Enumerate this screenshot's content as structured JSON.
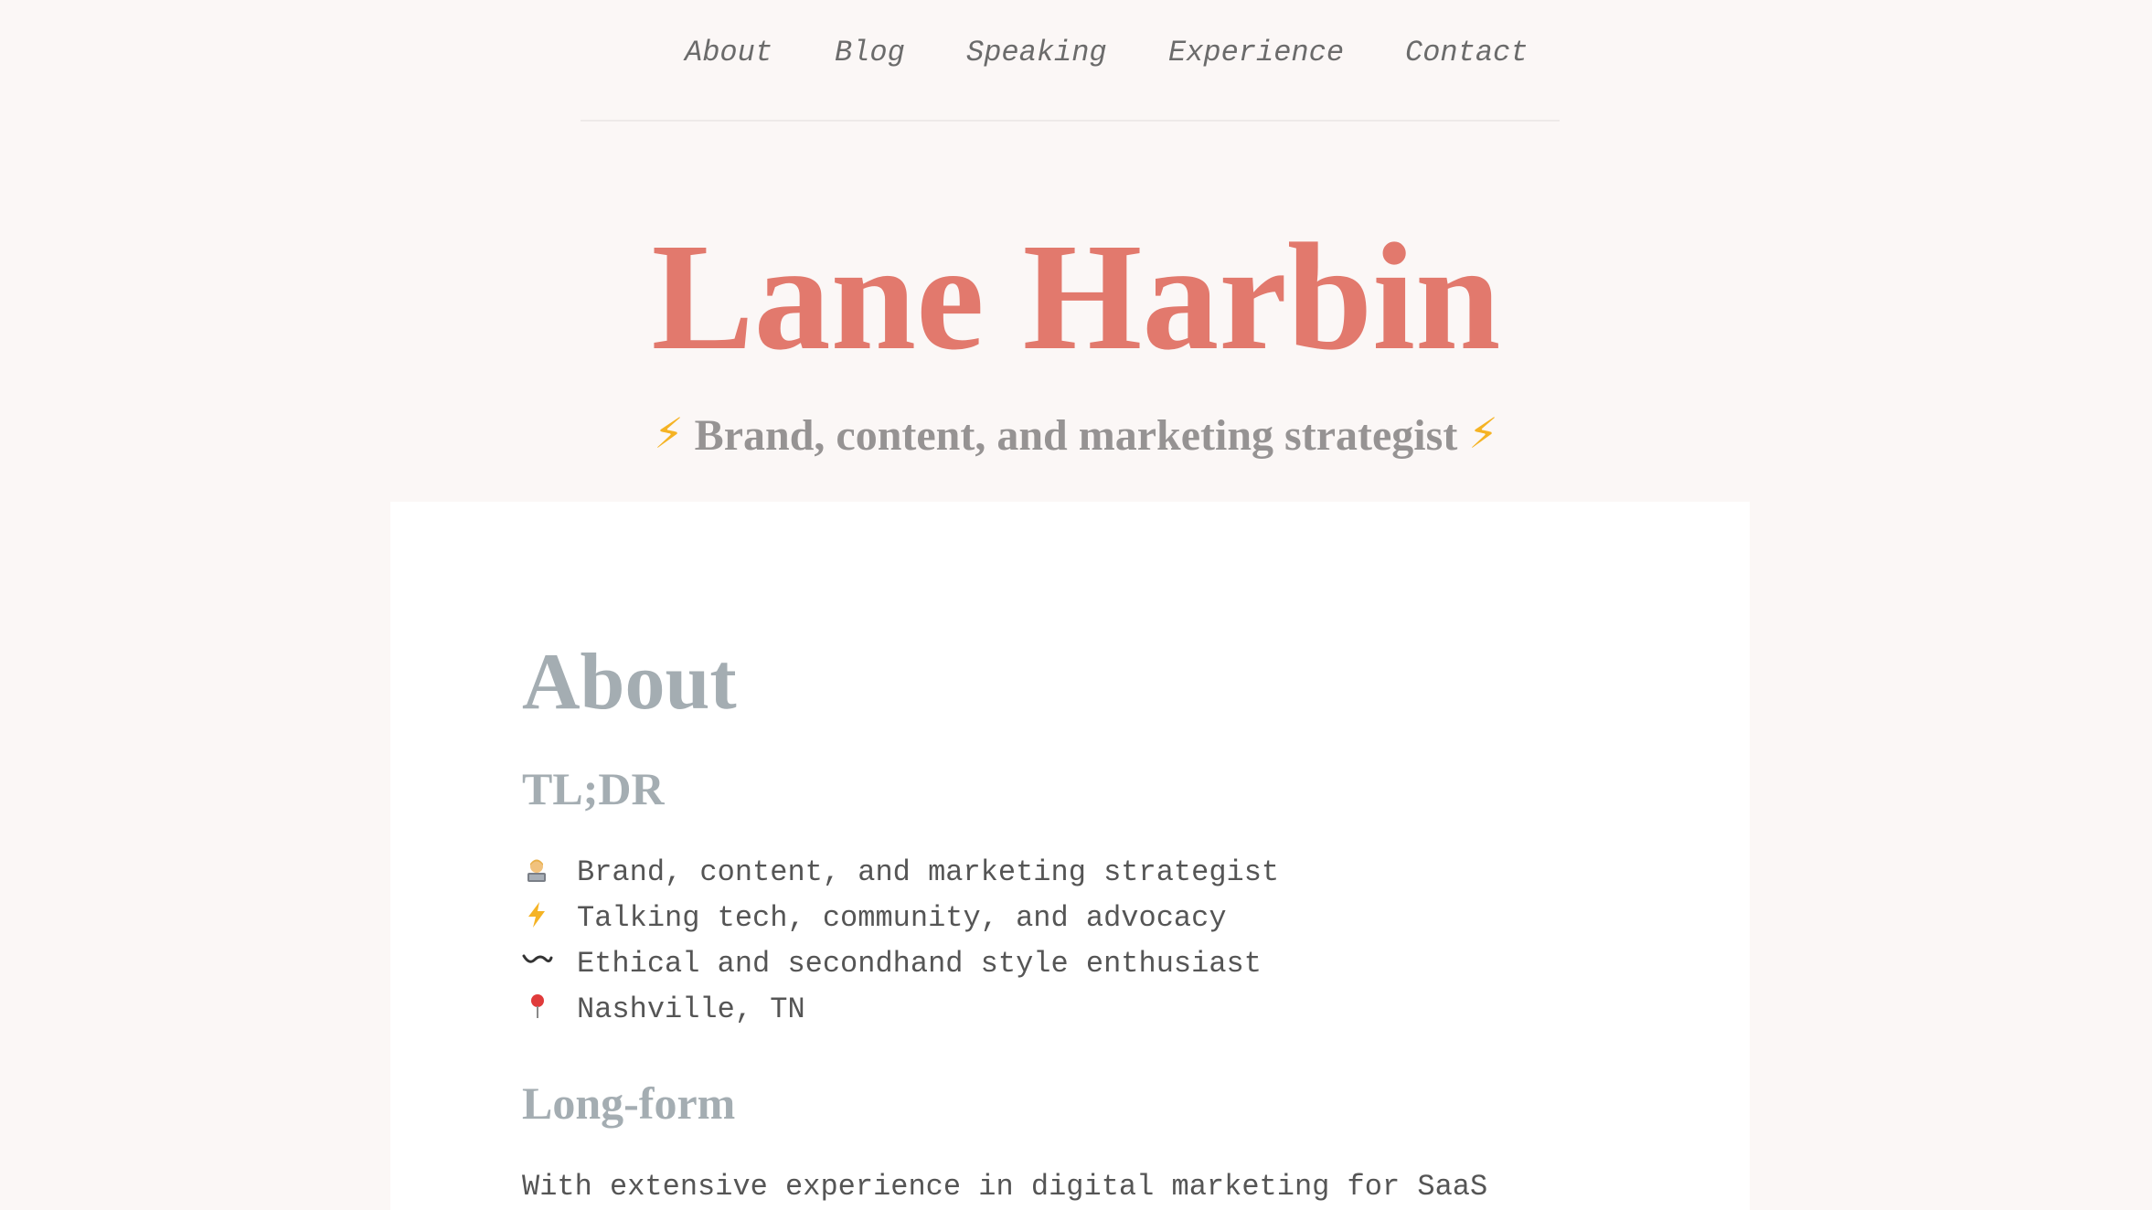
{
  "nav": {
    "items": [
      {
        "label": "About"
      },
      {
        "label": "Blog"
      },
      {
        "label": "Speaking"
      },
      {
        "label": "Experience"
      },
      {
        "label": "Contact"
      }
    ]
  },
  "header": {
    "title": "Lane Harbin",
    "tagline": "Brand, content, and marketing strategist",
    "tagline_icon": "lightning-bolt-emoji"
  },
  "about": {
    "title": "About",
    "tldr": {
      "heading": "TL;DR",
      "items": [
        {
          "icon": "technologist-emoji",
          "text": "Brand, content, and marketing strategist"
        },
        {
          "icon": "lightning-bolt-emoji",
          "text": "Talking tech, community, and advocacy"
        },
        {
          "icon": "wavy-dash-icon",
          "text": "Ethical and secondhand style enthusiast"
        },
        {
          "icon": "pushpin-emoji",
          "text": "Nashville, TN"
        }
      ]
    },
    "longform": {
      "heading": "Long-form",
      "text": "With extensive experience in digital marketing for SaaS"
    }
  },
  "colors": {
    "background": "#fbf7f6",
    "card": "#ffffff",
    "title_accent": "#e2796d",
    "heading_gray": "#a4adb2",
    "tagline_gray": "#969393",
    "body_text": "#555555",
    "nav_text": "#6b6b6b",
    "bolt_yellow": "#f5b324"
  }
}
